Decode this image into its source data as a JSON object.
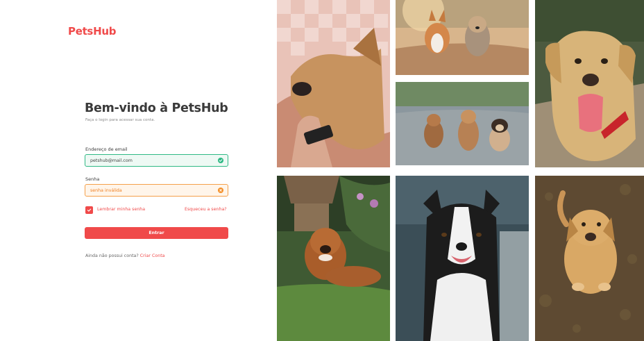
{
  "brand": {
    "logo": "PetsHub",
    "accent": "#f04a4a"
  },
  "login": {
    "title": "Bem-vindo à PetsHub",
    "subtitle": "Faça o login para acessar sua conta.",
    "email_label": "Endereço de email",
    "email_value": "petshub@mail.com",
    "email_status": "valid",
    "password_label": "Senha",
    "password_value": "senha inválida",
    "password_status": "invalid",
    "remember_label": "Lembrar minha senha",
    "remember_checked": true,
    "forgot_label": "Esqueceu a senha?",
    "submit_label": "Entrar",
    "signup_prompt": "Ainda não possui conta?",
    "signup_link": "Criar Conta"
  },
  "gallery": {
    "photos": [
      {
        "subject": "dog-with-hand-photo"
      },
      {
        "subject": "two-dogs-running-photo"
      },
      {
        "subject": "three-puppies-photo"
      },
      {
        "subject": "labrador-tongue-photo"
      },
      {
        "subject": "dog-in-garden-photo"
      },
      {
        "subject": "border-collie-photo"
      },
      {
        "subject": "dog-sitting-grass-photo"
      }
    ]
  },
  "colors": {
    "valid": "#2fb985",
    "invalid": "#f4902a"
  }
}
